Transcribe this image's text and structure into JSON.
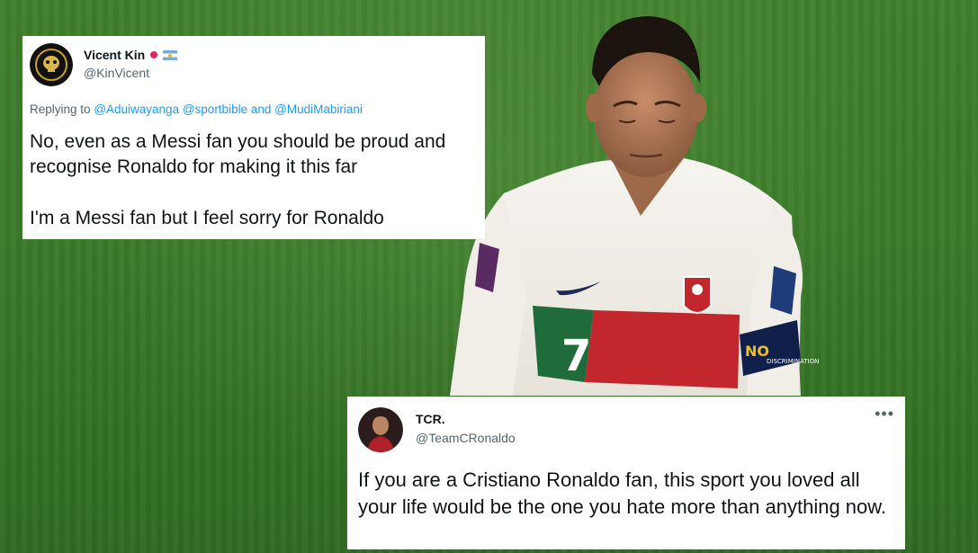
{
  "tweets": [
    {
      "display_name": "Vicent Kin",
      "handle": "@KinVicent",
      "reply_prefix": "Replying to",
      "reply_mentions": [
        "@Aduiwayanga",
        "@sportbible",
        "and",
        "@MudiMabiriani"
      ],
      "paragraphs": [
        "No, even as a Messi fan you should be proud and recognise Ronaldo for making it this far",
        "I'm a Messi fan but I feel sorry for Ronaldo"
      ],
      "badges": [
        "red-dot-icon",
        "argentina-flag-icon"
      ]
    },
    {
      "display_name": "TCR.",
      "handle": "@TeamCRonaldo",
      "more": "•••",
      "paragraphs": [
        "If you are a Cristiano Ronaldo fan, this sport you loved all your life would be the one you hate more than anything now."
      ]
    }
  ],
  "jersey": {
    "number": "7",
    "armband": "NO",
    "armband_sub": "DISCRIMINATION"
  },
  "colors": {
    "pitch": "#3a7a29",
    "jersey_white": "#f3f1ec",
    "jersey_red": "#c1272d",
    "jersey_green": "#1f6b3a",
    "mention_blue": "#1d9bf0",
    "handle_grey": "#536471"
  }
}
